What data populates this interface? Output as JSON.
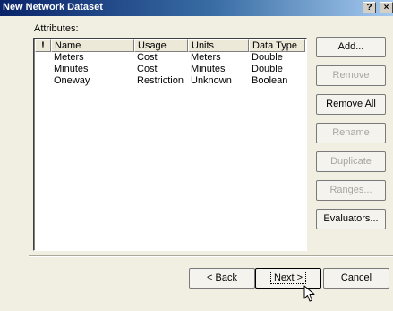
{
  "window": {
    "title": "New Network Dataset",
    "help_glyph": "?",
    "close_glyph": "×"
  },
  "attributes": {
    "label": "Attributes:",
    "columns": [
      "!",
      "Name",
      "Usage",
      "Units",
      "Data Type"
    ],
    "rows": [
      {
        "name": "Meters",
        "usage": "Cost",
        "units": "Meters",
        "data_type": "Double"
      },
      {
        "name": "Minutes",
        "usage": "Cost",
        "units": "Minutes",
        "data_type": "Double"
      },
      {
        "name": "Oneway",
        "usage": "Restriction",
        "units": "Unknown",
        "data_type": "Boolean"
      }
    ]
  },
  "side_buttons": [
    {
      "label": "Add...",
      "enabled": true
    },
    {
      "label": "Remove",
      "enabled": false
    },
    {
      "label": "Remove All",
      "enabled": true
    },
    {
      "label": "Rename",
      "enabled": false
    },
    {
      "label": "Duplicate",
      "enabled": false
    },
    {
      "label": "Ranges...",
      "enabled": false
    },
    {
      "label": "Evaluators...",
      "enabled": true
    }
  ],
  "nav": {
    "back": "< Back",
    "next": "Next >",
    "cancel": "Cancel"
  }
}
